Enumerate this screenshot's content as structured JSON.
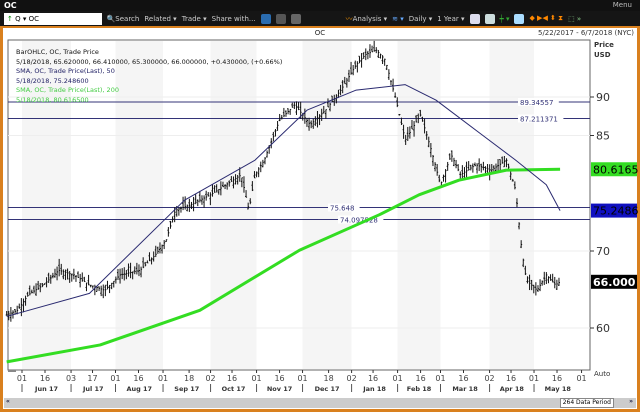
{
  "window": {
    "title": "OC",
    "menu": "Menu"
  },
  "toolbar": {
    "ticker": "OC",
    "search": "Search",
    "related": "Related",
    "trade": "Trade",
    "share": "Share with...",
    "analysis": "Analysis",
    "interval": "Daily",
    "range": "1 Year"
  },
  "header": {
    "title": "OC",
    "date_range": "5/22/2017 - 6/7/2018 (NYC)"
  },
  "legend": [
    "BarOHLC, OC, Trade Price",
    "5/18/2018, 65.620000, 66.410000, 65.300000, 66.000000, +0.430000, (+0.66%)",
    "SMA, OC, Trade Price(Last),  50",
    "5/18/2018, 75.248600",
    "SMA, OC, Trade Price(Last),  200",
    "5/18/2018, 80.616500"
  ],
  "footer": {
    "period": "264 Data Period",
    "auto": "Auto"
  },
  "colors": {
    "sma50": "#2a2a70",
    "sma200": "#33dd22",
    "bars": "#111111",
    "frame": "#d9801e"
  },
  "chart_data": {
    "type": "line",
    "title": "OC",
    "ylabel": "Price USD",
    "ylabel_lines": [
      "Price",
      "USD"
    ],
    "ylim": [
      54,
      98
    ],
    "yticks": [
      "90",
      "85",
      "70",
      "60"
    ],
    "ytick_values": [
      90,
      85,
      70,
      60
    ],
    "xtick_labels": [
      "01",
      "16",
      "03",
      "17",
      "01",
      "16",
      "01",
      "18",
      "02",
      "16",
      "01",
      "16",
      "01",
      "18",
      "02",
      "16",
      "01",
      "16",
      "01",
      "16",
      "02",
      "16",
      "01",
      "16",
      "01"
    ],
    "xtick_dates": [
      "2017-06-01",
      "2017-06-16",
      "2017-07-03",
      "2017-07-17",
      "2017-08-01",
      "2017-08-16",
      "2017-09-01",
      "2017-09-18",
      "2017-10-02",
      "2017-10-16",
      "2017-11-01",
      "2017-11-16",
      "2017-12-01",
      "2017-12-18",
      "2018-01-02",
      "2018-01-16",
      "2018-02-01",
      "2018-02-16",
      "2018-03-01",
      "2018-03-16",
      "2018-04-02",
      "2018-04-16",
      "2018-05-01",
      "2018-05-16",
      "2018-06-01"
    ],
    "month_labels": [
      "Jun 17",
      "Jul 17",
      "Aug 17",
      "Sep 17",
      "Oct 17",
      "Nov 17",
      "Dec 17",
      "Jan 18",
      "Feb 18",
      "Mar 18",
      "Apr 18",
      "May 18"
    ],
    "price": [
      [
        "2017-05-22",
        61.7
      ],
      [
        "2017-05-29",
        62.3
      ],
      [
        "2017-06-05",
        64.3
      ],
      [
        "2017-06-15",
        65.6
      ],
      [
        "2017-06-25",
        67.5
      ],
      [
        "2017-07-05",
        66.9
      ],
      [
        "2017-07-15",
        65.6
      ],
      [
        "2017-07-25",
        64.9
      ],
      [
        "2017-08-04",
        66.9
      ],
      [
        "2017-08-17",
        67.5
      ],
      [
        "2017-08-27",
        69.5
      ],
      [
        "2017-09-03",
        71.4
      ],
      [
        "2017-09-09",
        75.3
      ],
      [
        "2017-09-19",
        76.0
      ],
      [
        "2017-10-02",
        77.3
      ],
      [
        "2017-10-12",
        78.6
      ],
      [
        "2017-10-22",
        79.9
      ],
      [
        "2017-10-27",
        75.3
      ],
      [
        "2017-10-31",
        79.9
      ],
      [
        "2017-11-06",
        81.8
      ],
      [
        "2017-11-16",
        87.0
      ],
      [
        "2017-11-26",
        89.0
      ],
      [
        "2017-12-06",
        86.4
      ],
      [
        "2017-12-16",
        88.3
      ],
      [
        "2017-12-26",
        90.9
      ],
      [
        "2018-01-05",
        94.2
      ],
      [
        "2018-01-11",
        95.5
      ],
      [
        "2018-01-18",
        96.1
      ],
      [
        "2018-01-24",
        94.8
      ],
      [
        "2018-01-31",
        89.6
      ],
      [
        "2018-02-06",
        84.4
      ],
      [
        "2018-02-16",
        87.7
      ],
      [
        "2018-02-23",
        83.1
      ],
      [
        "2018-03-01",
        78.6
      ],
      [
        "2018-03-08",
        82.5
      ],
      [
        "2018-03-14",
        79.9
      ],
      [
        "2018-03-24",
        81.2
      ],
      [
        "2018-04-03",
        80.5
      ],
      [
        "2018-04-13",
        81.8
      ],
      [
        "2018-04-19",
        77.9
      ],
      [
        "2018-04-23",
        70.1
      ],
      [
        "2018-04-26",
        66.2
      ],
      [
        "2018-05-03",
        64.9
      ],
      [
        "2018-05-09",
        66.9
      ],
      [
        "2018-05-15",
        65.6
      ],
      [
        "2018-05-18",
        66.0
      ]
    ],
    "sma50": [
      [
        "2017-05-22",
        61.5
      ],
      [
        "2017-07-15",
        64.5
      ],
      [
        "2017-09-15",
        76.6
      ],
      [
        "2017-10-31",
        81.8
      ],
      [
        "2017-12-04",
        88.3
      ],
      [
        "2018-01-05",
        90.9
      ],
      [
        "2018-02-06",
        91.6
      ],
      [
        "2018-02-26",
        89.6
      ],
      [
        "2018-03-24",
        85.7
      ],
      [
        "2018-04-19",
        81.8
      ],
      [
        "2018-05-09",
        78.6
      ],
      [
        "2018-05-18",
        75.2486
      ]
    ],
    "sma200": [
      [
        "2017-05-22",
        55.6
      ],
      [
        "2017-07-22",
        57.8
      ],
      [
        "2017-09-25",
        62.3
      ],
      [
        "2017-11-29",
        70.1
      ],
      [
        "2018-01-20",
        74.7
      ],
      [
        "2018-02-15",
        77.3
      ],
      [
        "2018-03-13",
        79.2
      ],
      [
        "2018-04-13",
        80.5
      ],
      [
        "2018-05-18",
        80.6165
      ]
    ],
    "levels": [
      {
        "value": 89.34557,
        "label": "89.34557"
      },
      {
        "value": 87.211371,
        "label": "87.211371"
      },
      {
        "value": 75.648,
        "label": "75.648"
      },
      {
        "value": 74.097528,
        "label": "74.097528"
      }
    ],
    "last_values": [
      {
        "label": "80.6165",
        "value": 80.6165,
        "color": "#33dd22",
        "text": "#000"
      },
      {
        "label": "75.2486",
        "value": 75.2486,
        "color": "#1010c0",
        "text": "#000"
      },
      {
        "label": "66.000",
        "value": 66.0,
        "color": "#000",
        "text": "#fff"
      }
    ]
  }
}
